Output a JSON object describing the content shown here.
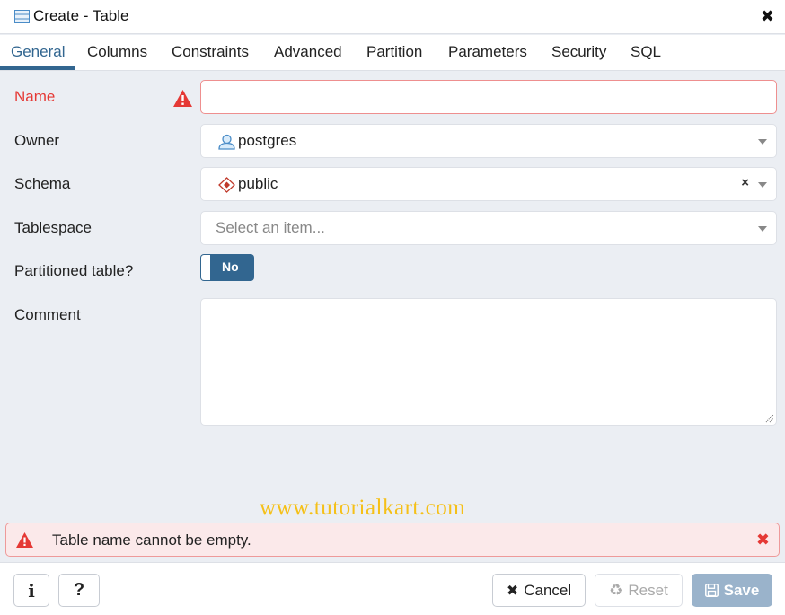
{
  "window": {
    "title": "Create - Table",
    "icon": "table-icon",
    "close_icon": "close-icon"
  },
  "tabs": [
    {
      "label": "General",
      "active": true
    },
    {
      "label": "Columns",
      "active": false
    },
    {
      "label": "Constraints",
      "active": false
    },
    {
      "label": "Advanced",
      "active": false
    },
    {
      "label": "Partition",
      "active": false
    },
    {
      "label": "Parameters",
      "active": false
    },
    {
      "label": "Security",
      "active": false
    },
    {
      "label": "SQL",
      "active": false
    }
  ],
  "form": {
    "name": {
      "label": "Name",
      "value": "",
      "error": true
    },
    "owner": {
      "label": "Owner",
      "value": "postgres",
      "icon": "user-icon"
    },
    "schema": {
      "label": "Schema",
      "value": "public",
      "icon": "schema-icon",
      "clear": "×"
    },
    "tablespace": {
      "label": "Tablespace",
      "placeholder": "Select an item..."
    },
    "partitioned": {
      "label": "Partitioned table?",
      "toggle_label": "No",
      "checked": false
    },
    "comment": {
      "label": "Comment",
      "value": ""
    }
  },
  "watermark": "www.tutorialkart.com",
  "alert": {
    "message": "Table name cannot be empty.",
    "close": "✖"
  },
  "footer": {
    "info_label": "i",
    "help_label": "?",
    "cancel_label": "Cancel",
    "reset_label": "Reset",
    "save_label": "Save"
  },
  "colors": {
    "accent": "#326690",
    "error": "#e53935",
    "save_disabled": "#9ab3cb"
  }
}
